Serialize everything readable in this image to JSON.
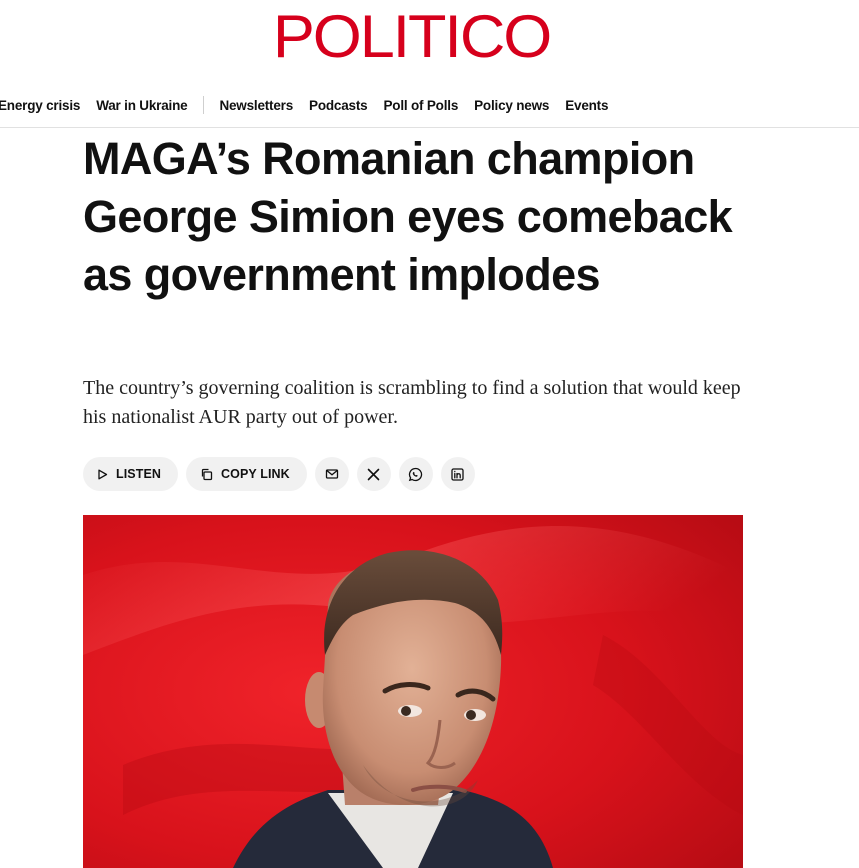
{
  "brand": {
    "logo_text": "POLITICO",
    "color": "#d6001c"
  },
  "nav": {
    "topics": [
      "Energy crisis",
      "War in Ukraine"
    ],
    "links": [
      "Newsletters",
      "Podcasts",
      "Poll of Polls",
      "Policy news",
      "Events"
    ]
  },
  "article": {
    "headline": "MAGA’s Romanian champion George Simion eyes comeback as government implodes",
    "dek": "The country’s governing coalition is scrambling to find a solution that would keep his nationalist AUR party out of power."
  },
  "share": {
    "listen_label": "LISTEN",
    "copy_label": "COPY LINK",
    "icons": [
      "play-icon",
      "copy-icon",
      "email-icon",
      "x-icon",
      "whatsapp-icon",
      "linkedin-icon"
    ]
  },
  "hero": {
    "background_color": "#e0141c"
  }
}
